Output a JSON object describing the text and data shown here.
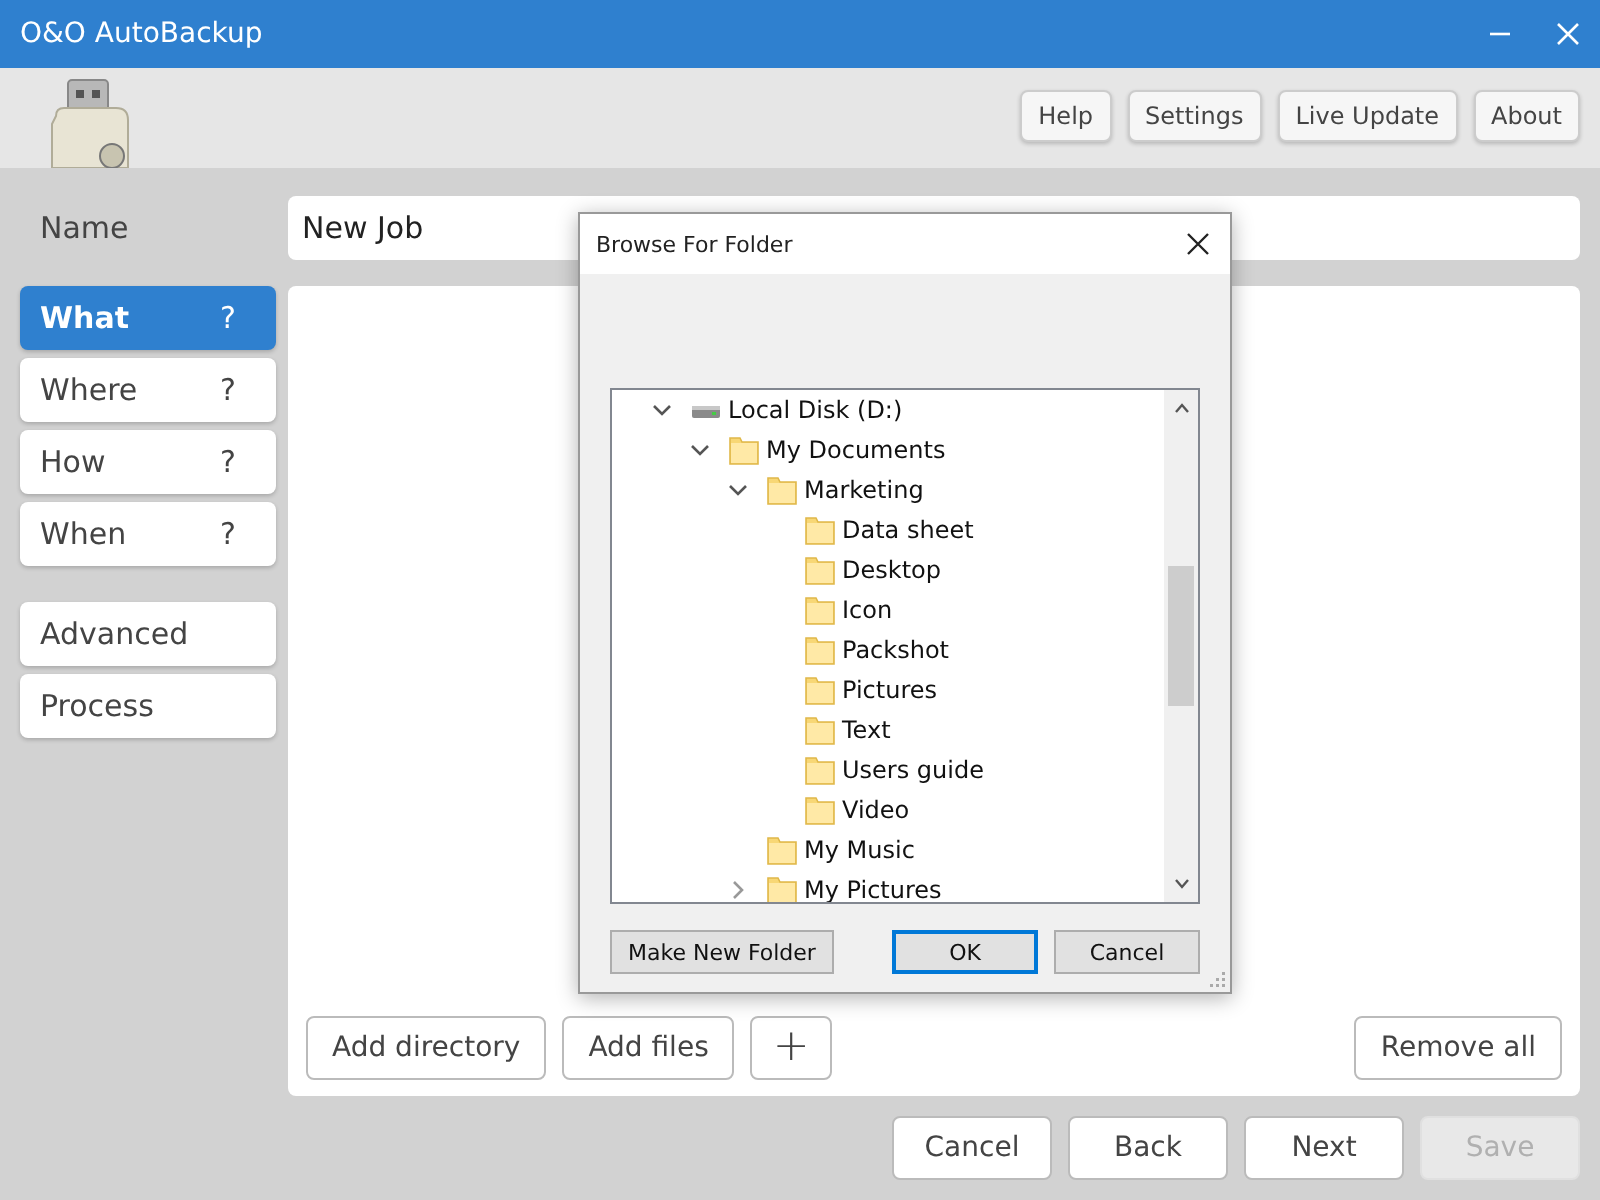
{
  "window": {
    "title": "O&O AutoBackup"
  },
  "header_buttons": [
    "Help",
    "Settings",
    "Live Update",
    "About"
  ],
  "name_field": {
    "label": "Name",
    "value": "New Job"
  },
  "sidebar": {
    "groups": [
      [
        {
          "label": "What",
          "help": "?",
          "selected": true
        },
        {
          "label": "Where",
          "help": "?",
          "selected": false
        },
        {
          "label": "How",
          "help": "?",
          "selected": false
        },
        {
          "label": "When",
          "help": "?",
          "selected": false
        }
      ],
      [
        {
          "label": "Advanced",
          "selected": false
        },
        {
          "label": "Process",
          "selected": false
        }
      ]
    ]
  },
  "content_buttons": {
    "left": [
      {
        "label": "Add directory",
        "kind": "text"
      },
      {
        "label": "Add files",
        "kind": "text"
      },
      {
        "label": "+",
        "kind": "icon"
      }
    ],
    "right": [
      {
        "label": "Remove all",
        "kind": "text"
      }
    ]
  },
  "footer_buttons": [
    {
      "label": "Cancel",
      "disabled": false
    },
    {
      "label": "Back",
      "disabled": false
    },
    {
      "label": "Next",
      "disabled": false
    },
    {
      "label": "Save",
      "disabled": true
    }
  ],
  "dialog": {
    "title": "Browse For Folder",
    "tree": [
      {
        "label": "Local Disk (D:)",
        "kind": "drive",
        "expanded": true,
        "children": [
          {
            "label": "My Documents",
            "kind": "folder",
            "expanded": true,
            "children": [
              {
                "label": "Marketing",
                "kind": "folder",
                "expanded": true,
                "children": [
                  {
                    "label": "Data sheet",
                    "kind": "folder"
                  },
                  {
                    "label": "Desktop",
                    "kind": "folder"
                  },
                  {
                    "label": "Icon",
                    "kind": "folder"
                  },
                  {
                    "label": "Packshot",
                    "kind": "folder"
                  },
                  {
                    "label": "Pictures",
                    "kind": "folder"
                  },
                  {
                    "label": "Text",
                    "kind": "folder"
                  },
                  {
                    "label": "Users guide",
                    "kind": "folder"
                  },
                  {
                    "label": "Video",
                    "kind": "folder"
                  }
                ]
              },
              {
                "label": "My Music",
                "kind": "folder"
              },
              {
                "label": "My Pictures",
                "kind": "folder",
                "expanded": false
              }
            ]
          }
        ]
      }
    ],
    "buttons": [
      {
        "label": "Make New Folder",
        "default": false
      },
      {
        "label": "OK",
        "default": true
      },
      {
        "label": "Cancel",
        "default": false
      }
    ]
  }
}
